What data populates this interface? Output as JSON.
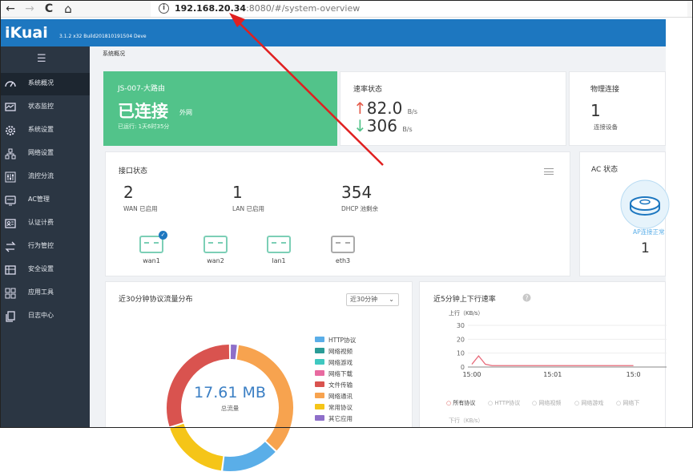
{
  "browser": {
    "back": "←",
    "forward": "→",
    "reload": "C",
    "home": "⌂",
    "url_host": "192.168.20.34",
    "url_path": ":8080/#/system-overview"
  },
  "header": {
    "logo": "iKuai",
    "version": "3.1.2 x32 Build201810191504 Deve"
  },
  "sidebar": {
    "toggle": "☰",
    "items": [
      {
        "label": "系统概况",
        "icon": "speedometer-icon"
      },
      {
        "label": "状态监控",
        "icon": "monitor-icon"
      },
      {
        "label": "系统设置",
        "icon": "gear-icon"
      },
      {
        "label": "网络设置",
        "icon": "network-icon"
      },
      {
        "label": "流控分流",
        "icon": "sliders-icon"
      },
      {
        "label": "AC管理",
        "icon": "ac-icon"
      },
      {
        "label": "认证计费",
        "icon": "id-card-icon"
      },
      {
        "label": "行为管控",
        "icon": "swap-icon"
      },
      {
        "label": "安全设置",
        "icon": "shield-icon"
      },
      {
        "label": "应用工具",
        "icon": "apps-icon"
      },
      {
        "label": "日志中心",
        "icon": "copy-icon"
      }
    ]
  },
  "breadcrumb": "系统概况",
  "wan_card": {
    "name": "JS-007-大路由",
    "status": "已连接",
    "sub": "外网",
    "uptime": "已运行: 1天6时35分"
  },
  "speed_card": {
    "title": "速率状态",
    "up_value": "82.0",
    "up_unit": "B/s",
    "down_value": "306",
    "down_unit": "B/s"
  },
  "phys_card": {
    "title": "物理连接",
    "value": "1",
    "label": "连接设备"
  },
  "iface_card": {
    "title": "接口状态",
    "stats": [
      {
        "value": "2",
        "label": "WAN 已启用"
      },
      {
        "value": "1",
        "label": "LAN 已启用"
      },
      {
        "value": "354",
        "label": "DHCP 池剩余"
      }
    ],
    "ports": [
      {
        "label": "wan1",
        "active": true,
        "checked": true
      },
      {
        "label": "wan2",
        "active": true,
        "checked": false
      },
      {
        "label": "lan1",
        "active": true,
        "checked": false
      },
      {
        "label": "eth3",
        "active": false,
        "checked": false
      }
    ]
  },
  "ac_card": {
    "title": "AC 状态",
    "ap_label": "AP连接正常",
    "value": "1"
  },
  "proto_card": {
    "title": "近30分钟协议流量分布",
    "dropdown": "近30分钟",
    "total_value": "17.61 MB",
    "total_label": "总流量",
    "legend": [
      {
        "name": "HTTP协议",
        "color": "#5aaee8"
      },
      {
        "name": "网络视频",
        "color": "#2a9c97"
      },
      {
        "name": "网络游戏",
        "color": "#3fc8c0"
      },
      {
        "name": "网络下载",
        "color": "#e86aa0"
      },
      {
        "name": "文件传输",
        "color": "#d9534f"
      },
      {
        "name": "网络通讯",
        "color": "#f7a34f"
      },
      {
        "name": "常用协议",
        "color": "#f5c518"
      },
      {
        "name": "其它应用",
        "color": "#8e6fc9"
      }
    ]
  },
  "rate_card": {
    "title": "近5分钟上下行速率",
    "up_label": "上行（KB/s）",
    "down_label": "下行（KB/s）",
    "y_ticks": [
      "30",
      "20",
      "10",
      "0"
    ],
    "x_ticks": [
      "15:00",
      "15:01",
      "15:0"
    ],
    "legend": [
      "所有协议",
      "HTTP协议",
      "网络视频",
      "网络游戏",
      "网络下"
    ]
  },
  "chart_data": [
    {
      "type": "pie",
      "title": "近30分钟协议流量分布",
      "categories": [
        "其它应用",
        "网络通讯",
        "HTTP协议",
        "常用协议",
        "文件传输"
      ],
      "values": [
        2,
        35,
        15,
        18,
        30
      ]
    },
    {
      "type": "line",
      "title": "近5分钟上下行速率",
      "ylabel": "上行（KB/s）",
      "ylim": [
        0,
        30
      ],
      "x": [
        "15:00",
        "",
        "",
        "",
        "",
        "",
        "",
        "",
        "",
        "",
        "",
        "",
        "15:01",
        "",
        "",
        "",
        "",
        "",
        "",
        "",
        "",
        "",
        "",
        "",
        "15:0"
      ],
      "series": [
        {
          "name": "所有协议",
          "values": [
            2,
            8,
            2,
            1,
            1,
            1,
            1,
            1,
            1,
            1,
            1,
            1,
            1,
            1,
            1,
            1,
            1,
            1,
            1,
            1,
            1,
            1,
            1,
            1,
            1
          ]
        }
      ]
    }
  ]
}
